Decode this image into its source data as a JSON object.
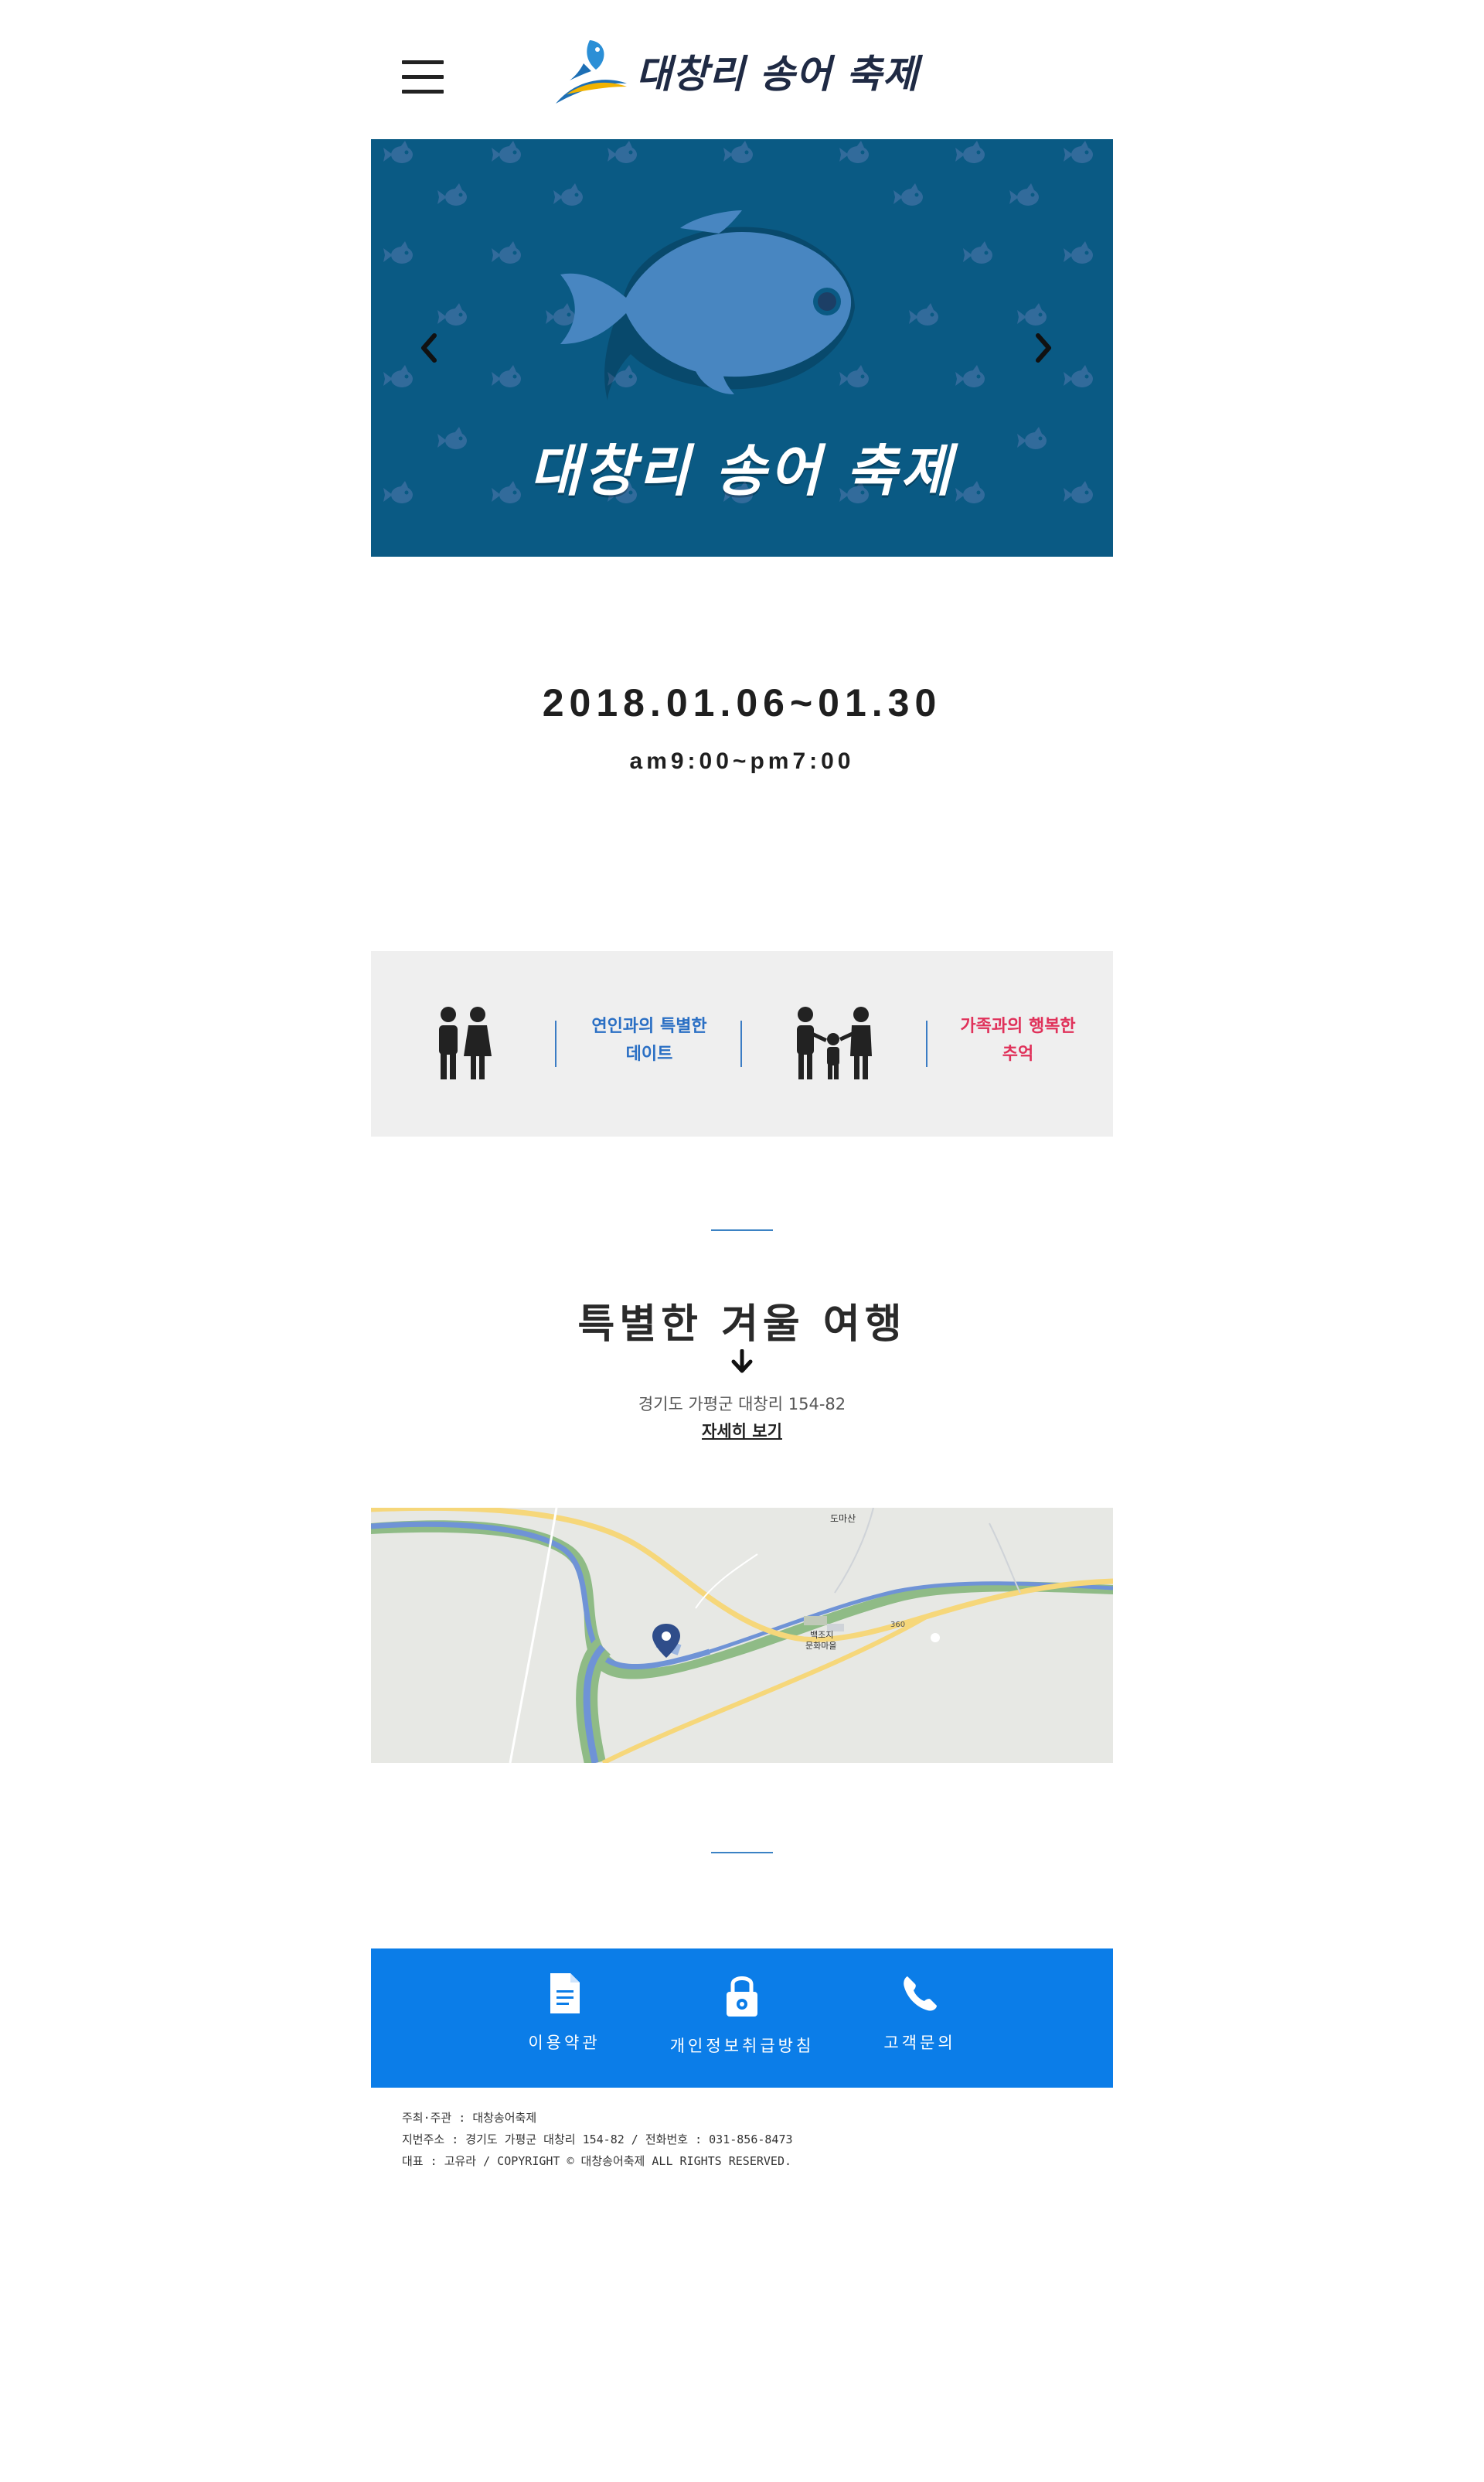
{
  "header": {
    "logo_text": "대창리 송어 축제",
    "menu_icon": "hamburger-menu-icon"
  },
  "hero": {
    "title": "대창리 송어 축제",
    "slide_count": 4,
    "active_slide": 1,
    "background_color": "#0a5a84",
    "prev_icon": "chevron-left-icon",
    "next_icon": "chevron-right-icon"
  },
  "event": {
    "date_range": "2018.01.06~01.30",
    "time_range": "am9:00~pm7:00"
  },
  "features": {
    "couple_icon": "couple-icon",
    "couple_label_line1": "연인과의 특별한",
    "couple_label_line2": "데이트",
    "family_icon": "family-icon",
    "family_label_line1": "가족과의 행복한",
    "family_label_line2": "추억",
    "couple_color": "#2a6fc4",
    "family_color": "#e0315a"
  },
  "travel": {
    "title": "특별한 겨울 여행",
    "address": "경기도 가평군 대창리 154-82",
    "detail_link": "자세히 보기"
  },
  "map": {
    "label_mountain": "도마산",
    "label_place_line1": "백조지",
    "label_place_line2": "문화마을",
    "label_route": "360",
    "marker_icon": "map-pin-icon"
  },
  "bottom_nav": {
    "background_color": "#0b7de8",
    "items": [
      {
        "label": "이용약관",
        "icon": "document-icon"
      },
      {
        "label": "개인정보취급방침",
        "icon": "lock-icon"
      },
      {
        "label": "고객문의",
        "icon": "phone-icon"
      }
    ]
  },
  "footer": {
    "line1": "주최·주관 : 대창송어축제",
    "line2": "지번주소 : 경기도 가평군 대창리 154-82  / 전화번호 : 031-856-8473",
    "line3": "대표 : 고유라 / COPYRIGHT © 대창송어축제 ALL RIGHTS RESERVED."
  }
}
